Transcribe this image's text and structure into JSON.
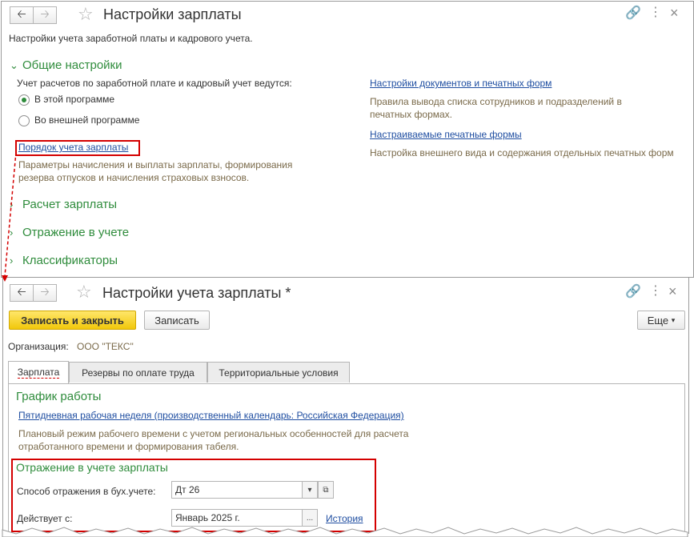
{
  "colors": {
    "accent_green": "#2f8c3c",
    "link_blue": "#1f4ea1",
    "highlight_red": "#d40000",
    "primary_yellow": "#f1c80b"
  },
  "window1": {
    "title": "Настройки зарплаты",
    "subtitle": "Настройки учета заработной платы и кадрового учета.",
    "general_section": "Общие настройки",
    "accounting_label": "Учет расчетов по заработной плате и кадровый учет ведутся:",
    "radio_this": "В этой программе",
    "radio_external": "Во внешней программе",
    "payroll_order_link": "Порядок учета зарплаты",
    "payroll_order_desc": "Параметры начисления и выплаты зарплаты, формирования резерва отпусков и начисления страховых взносов.",
    "docs_link": "Настройки документов и печатных форм",
    "docs_desc": "Правила вывода списка сотрудников и подразделений в печатных формах.",
    "print_forms_link": "Настраиваемые печатные формы",
    "print_forms_desc": "Настройка внешнего вида и содержания отдельных печатных форм",
    "section_calc": "Расчет зарплаты",
    "section_reflect": "Отражение в учете",
    "section_classifiers": "Классификаторы"
  },
  "window2": {
    "title": "Настройки учета зарплаты *",
    "save_close": "Записать и закрыть",
    "save": "Записать",
    "more": "Еще",
    "org_label": "Организация:",
    "org_value": "ООО \"ТЕКС\"",
    "tabs": [
      "Зарплата",
      "Резервы по оплате труда",
      "Территориальные условия"
    ],
    "schedule_head": "График работы",
    "schedule_link": "Пятидневная рабочая неделя (производственный календарь: Российская Федерация)",
    "schedule_desc": "Плановый режим рабочего времени с учетом региональных особенностей для расчета отработанного времени и формирования табеля.",
    "reflect_head": "Отражение в учете зарплаты",
    "method_label": "Способ отражения в бух.учете:",
    "method_value": "Дт 26",
    "effective_label": "Действует с:",
    "effective_value": "Январь 2025 г.",
    "history_link": "История"
  }
}
